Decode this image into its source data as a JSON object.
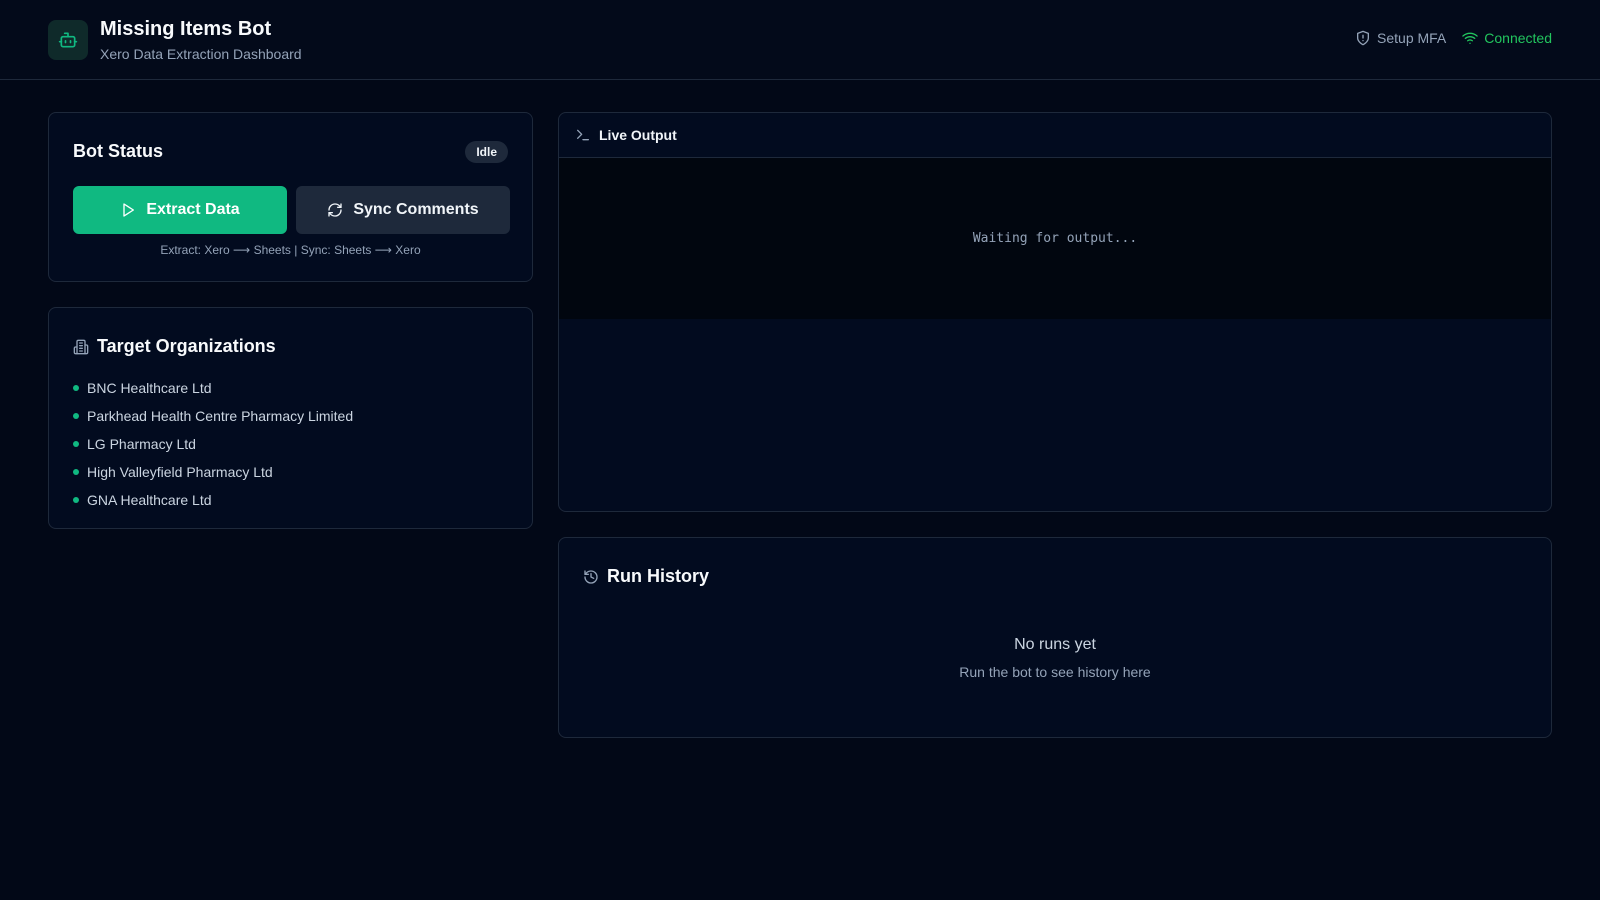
{
  "app": {
    "title": "Missing Items Bot",
    "subtitle": "Xero Data Extraction Dashboard",
    "logo_icon": "bot-icon"
  },
  "header": {
    "mfa_label": "Setup MFA",
    "connection_label": "Connected",
    "connection_color": "#22c55e"
  },
  "bot_status": {
    "title": "Bot Status",
    "badge": "Idle",
    "extract_label": "Extract Data",
    "sync_label": "Sync Comments",
    "hint": "Extract: Xero ⟶ Sheets | Sync: Sheets ⟶ Xero",
    "accent": "#10b981"
  },
  "organizations": {
    "title": "Target Organizations",
    "items": [
      "BNC Healthcare Ltd",
      "Parkhead Health Centre Pharmacy Limited",
      "LG Pharmacy Ltd",
      "High Valleyfield Pharmacy Ltd",
      "GNA Healthcare Ltd"
    ]
  },
  "live_output": {
    "title": "Live Output",
    "placeholder": "Waiting for output..."
  },
  "run_history": {
    "title": "Run History",
    "empty_title": "No runs yet",
    "empty_subtitle": "Run the bot to see history here"
  }
}
